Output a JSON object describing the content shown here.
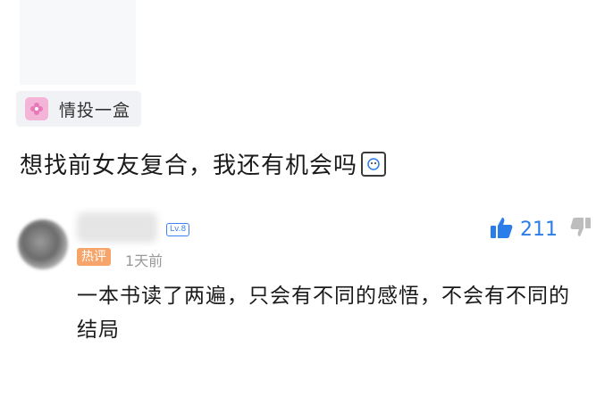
{
  "post": {
    "tag_label": "情投一盒",
    "question": "想找前女友复合，我还有机会吗"
  },
  "comment": {
    "level": "Lv.8",
    "hot_badge": "热评",
    "time": "1天前",
    "likes": "211",
    "text_line1": "一本书读了两遍，只会有不同的感悟，不会有不同的",
    "text_line2": "结局"
  },
  "colors": {
    "accent_blue": "#2b7de9",
    "hot_orange": "#f7a46a",
    "tag_pink": "#f3b4d8"
  },
  "icons": {
    "tag": "flower-icon",
    "like": "thumbs-up-icon",
    "dislike": "thumbs-down-icon",
    "emoji": "emoji-icon"
  }
}
